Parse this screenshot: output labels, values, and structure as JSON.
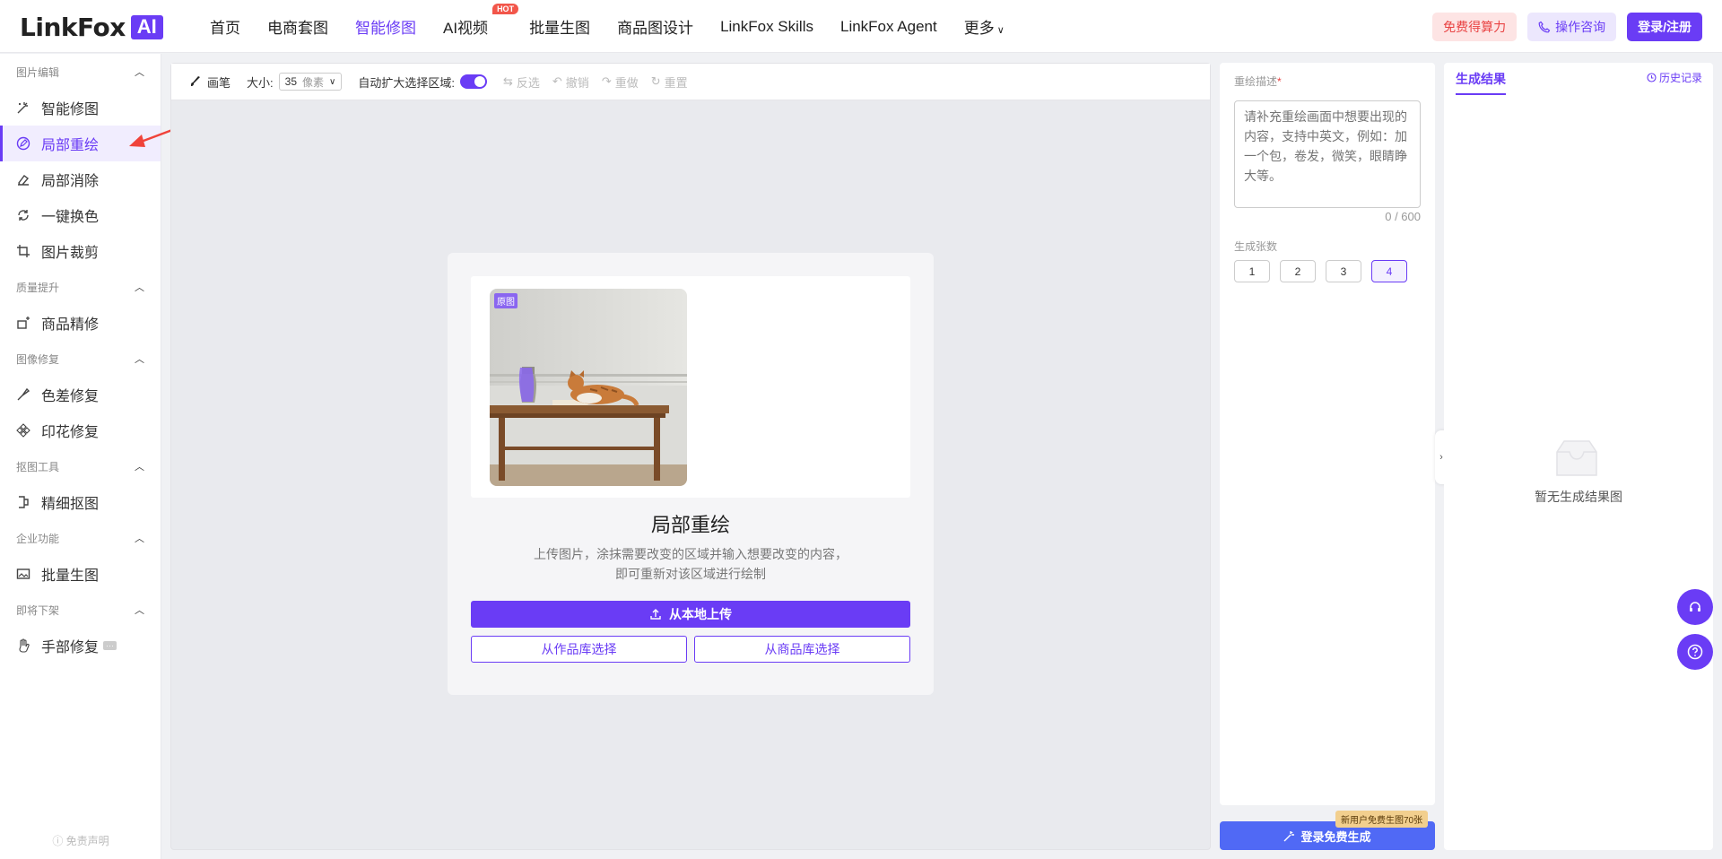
{
  "brand": {
    "logo_text": "LinkFox",
    "logo_badge": "AI"
  },
  "nav": {
    "items": [
      "首页",
      "电商套图",
      "智能修图",
      "AI视频",
      "批量生图",
      "商品图设计",
      "LinkFox Skills",
      "LinkFox Agent",
      "更多"
    ],
    "active": "智能修图",
    "hot_badge": "HOT"
  },
  "top_actions": {
    "free": "免费得算力",
    "consult": "操作咨询",
    "login": "登录/注册"
  },
  "sidebar": {
    "groups": [
      {
        "title": "图片编辑",
        "items": [
          "智能修图",
          "局部重绘",
          "局部消除",
          "一键换色",
          "图片裁剪"
        ]
      },
      {
        "title": "质量提升",
        "items": [
          "商品精修"
        ]
      },
      {
        "title": "图像修复",
        "items": [
          "色差修复",
          "印花修复"
        ]
      },
      {
        "title": "抠图工具",
        "items": [
          "精细抠图"
        ]
      },
      {
        "title": "企业功能",
        "items": [
          "批量生图"
        ]
      },
      {
        "title": "即将下架",
        "items": [
          "手部修复"
        ]
      }
    ],
    "active": "局部重绘",
    "disclaimer": "免责声明"
  },
  "toolbar": {
    "brush": "画笔",
    "size_label": "大小:",
    "size_value": "35",
    "size_unit": "像素",
    "auto_expand": "自动扩大选择区域:",
    "auto_expand_on": true,
    "invert": "反选",
    "undo": "撤销",
    "redo": "重做",
    "reset": "重置"
  },
  "card": {
    "badge": "原图",
    "title": "局部重绘",
    "desc_line1": "上传图片，涂抹需要改变的区域并输入想要改变的内容，",
    "desc_line2": "即可重新对该区域进行绘制",
    "upload": "从本地上传",
    "from_works": "从作品库选择",
    "from_products": "从商品库选择"
  },
  "params": {
    "desc_label": "重绘描述",
    "desc_required": "*",
    "desc_placeholder": "请补充重绘画面中想要出现的内容，支持中英文，例如：加一个包，卷发，微笑，眼睛睁大等。",
    "counter": "0 / 600",
    "count_label": "生成张数",
    "counts": [
      "1",
      "2",
      "3",
      "4"
    ],
    "selected_count": "4",
    "generate": "登录免费生成",
    "promo": "新用户免费生图70张"
  },
  "results": {
    "tab": "生成结果",
    "history": "历史记录",
    "empty": "暂无生成结果图"
  },
  "colors": {
    "accent": "#6a3cf5",
    "generate_button": "#5069f5",
    "free_text": "#e94343",
    "annotation_arrow": "#f0433a"
  }
}
